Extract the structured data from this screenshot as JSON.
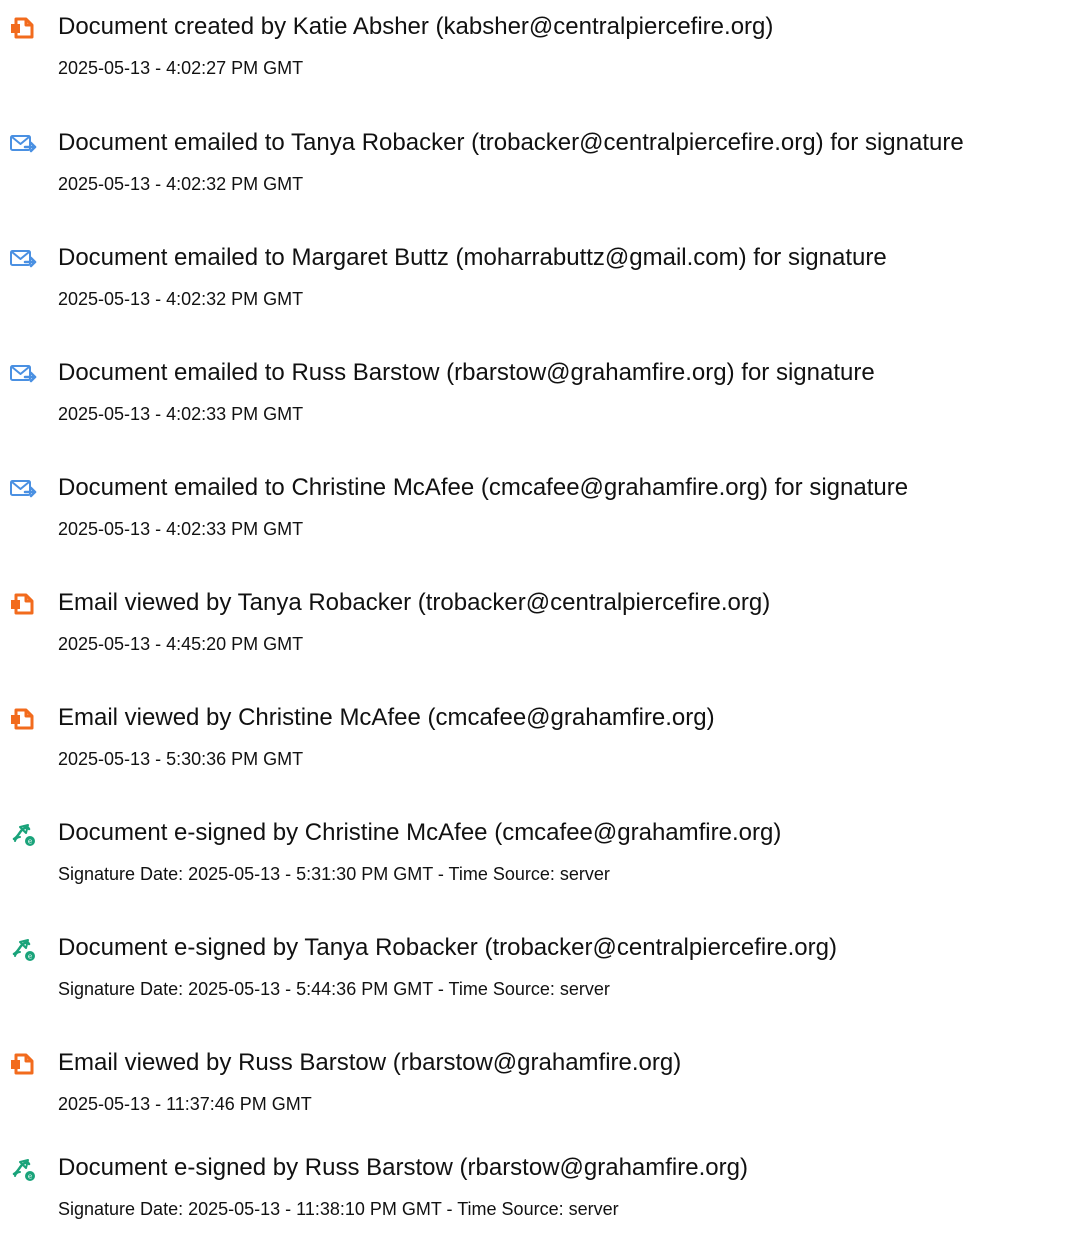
{
  "events": [
    {
      "icon": "document-created-icon",
      "title": "Document created by Katie Absher (kabsher@centralpiercefire.org)",
      "detail": "2025-05-13 - 4:02:27 PM GMT"
    },
    {
      "icon": "email-sent-icon",
      "title": "Document emailed to Tanya Robacker (trobacker@centralpiercefire.org) for signature",
      "detail": "2025-05-13 - 4:02:32 PM GMT"
    },
    {
      "icon": "email-sent-icon",
      "title": "Document emailed to Margaret Buttz (moharrabuttz@gmail.com) for signature",
      "detail": "2025-05-13 - 4:02:32 PM GMT"
    },
    {
      "icon": "email-sent-icon",
      "title": "Document emailed to Russ Barstow (rbarstow@grahamfire.org) for signature",
      "detail": "2025-05-13 - 4:02:33 PM GMT"
    },
    {
      "icon": "email-sent-icon",
      "title": "Document emailed to Christine McAfee (cmcafee@grahamfire.org) for signature",
      "detail": "2025-05-13 - 4:02:33 PM GMT"
    },
    {
      "icon": "document-viewed-icon",
      "title": "Email viewed by Tanya Robacker (trobacker@centralpiercefire.org)",
      "detail": "2025-05-13 - 4:45:20 PM GMT"
    },
    {
      "icon": "document-viewed-icon",
      "title": "Email viewed by Christine McAfee (cmcafee@grahamfire.org)",
      "detail": "2025-05-13 - 5:30:36 PM GMT"
    },
    {
      "icon": "e-signed-pen-icon",
      "title": "Document e-signed by Christine McAfee (cmcafee@grahamfire.org)",
      "detail": "Signature Date: 2025-05-13 - 5:31:30 PM GMT - Time Source: server"
    },
    {
      "icon": "e-signed-pen-icon",
      "title": "Document e-signed by Tanya Robacker (trobacker@centralpiercefire.org)",
      "detail": "Signature Date: 2025-05-13 - 5:44:36 PM GMT - Time Source: server"
    },
    {
      "icon": "document-viewed-icon",
      "title": "Email viewed by Russ Barstow (rbarstow@grahamfire.org)",
      "detail": "2025-05-13 - 11:37:46 PM GMT"
    },
    {
      "icon": "e-signed-pen-icon",
      "title": "Document e-signed by Russ Barstow (rbarstow@grahamfire.org)",
      "detail": "Signature Date: 2025-05-13 - 11:38:10 PM GMT - Time Source: server"
    }
  ],
  "colors": {
    "document_icon": "#f26b1d",
    "email_icon": "#4a90e2",
    "sign_icon": "#1aa37a",
    "text": "#111111"
  }
}
